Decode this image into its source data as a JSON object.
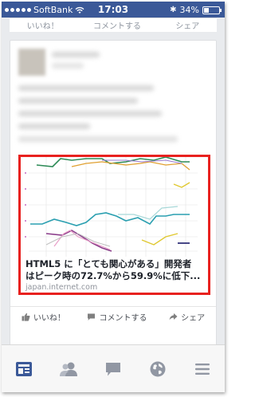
{
  "status_bar": {
    "carrier": "SoftBank",
    "time": "17:03",
    "battery": "34%",
    "battery_level": 0.34
  },
  "prev_actions": {
    "like": "いいね！",
    "comment": "コメントする",
    "share": "シェア"
  },
  "link": {
    "title_line1": "HTML5 に「とても関心がある」開発者",
    "title_line2": "はピーク時の72.7%から59.9%に低下...",
    "domain": "japan.internet.com"
  },
  "actions": {
    "like": "いいね！",
    "comment": "コメントする",
    "share": "シェア"
  },
  "tabs": [
    {
      "name": "news-feed-icon",
      "active": true
    },
    {
      "name": "friends-icon",
      "active": false
    },
    {
      "name": "messages-icon",
      "active": false
    },
    {
      "name": "notifications-globe-icon",
      "active": false
    },
    {
      "name": "menu-icon",
      "active": false
    }
  ],
  "colors": {
    "brand": "#3b5998",
    "highlight": "#e8211f",
    "active_tab": "#3b5998",
    "inactive_tab": "#9197a3"
  }
}
